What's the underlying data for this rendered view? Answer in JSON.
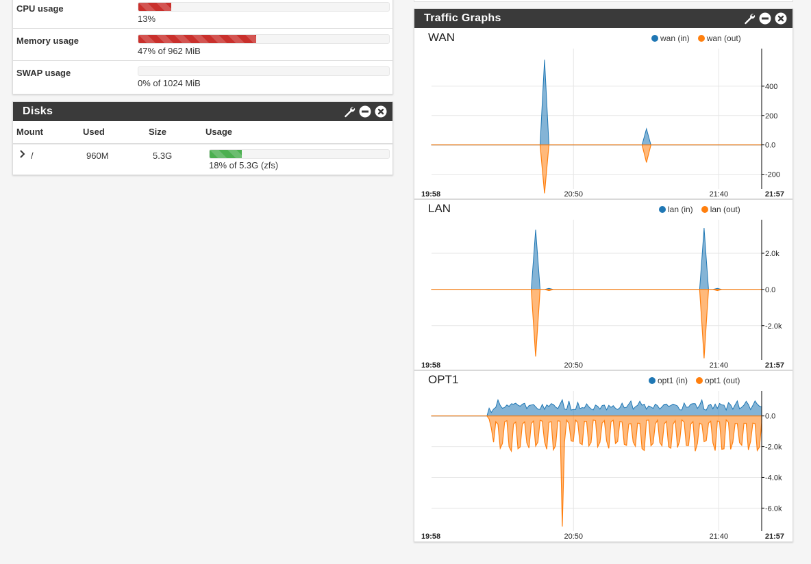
{
  "system": {
    "rows": [
      {
        "label": "CPU usage",
        "percent": 13,
        "detail": "13%"
      },
      {
        "label": "Memory usage",
        "percent": 47,
        "detail": "47% of 962 MiB"
      },
      {
        "label": "SWAP usage",
        "percent": 0,
        "detail": "0% of 1024 MiB"
      }
    ]
  },
  "disks": {
    "title": "Disks",
    "columns": [
      "Mount",
      "Used",
      "Size",
      "Usage"
    ],
    "row": {
      "mount": "/",
      "used": "960M",
      "size": "5.3G",
      "percent": 18,
      "usage_text": "18% of 5.3G (zfs)"
    }
  },
  "traffic": {
    "title": "Traffic Graphs",
    "colors": {
      "in": "#1f77b4",
      "out": "#ff7f0e"
    },
    "x_labels": {
      "start": "19:58",
      "t1": "20:50",
      "t2": "21:40",
      "end": "21:57"
    },
    "graphs": [
      {
        "name": "WAN",
        "legend_in": "wan (in)",
        "legend_out": "wan (out)",
        "ylim": [
          -300,
          600
        ],
        "yticks": [
          "400",
          "200",
          "0.0",
          "-200"
        ],
        "ytick_values": [
          400,
          200,
          0,
          -200
        ]
      },
      {
        "name": "LAN",
        "legend_in": "lan (in)",
        "legend_out": "lan (out)",
        "ylim": [
          -3900,
          3400
        ],
        "yticks": [
          "2.0k",
          "0.0",
          "-2.0k"
        ],
        "ytick_values": [
          2000,
          0,
          -2000
        ]
      },
      {
        "name": "OPT1",
        "legend_in": "opt1 (in)",
        "legend_out": "opt1 (out)",
        "ylim": [
          -7500,
          1100
        ],
        "yticks": [
          "0.0",
          "-2.0k",
          "-4.0k",
          "-6.0k"
        ],
        "ytick_values": [
          0,
          -2000,
          -4000,
          -6000
        ]
      }
    ]
  }
}
